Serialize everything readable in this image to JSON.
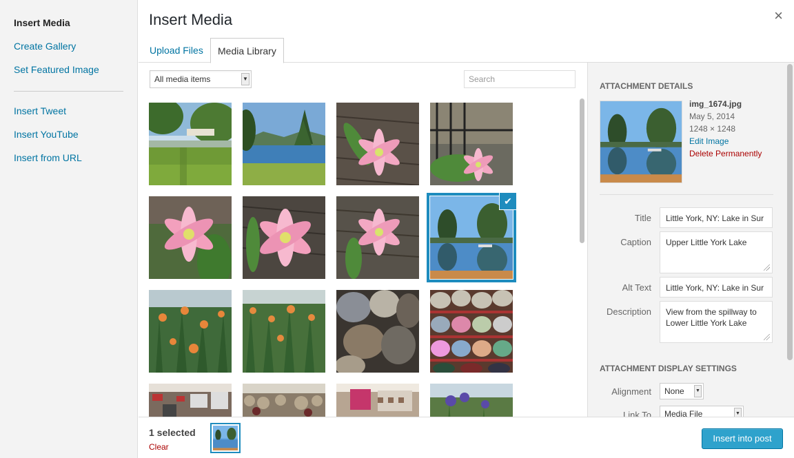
{
  "menu": {
    "items": [
      {
        "label": "Insert Media",
        "active": true
      },
      {
        "label": "Create Gallery"
      },
      {
        "label": "Set Featured Image"
      },
      {
        "label": "Insert Tweet"
      },
      {
        "label": "Insert YouTube"
      },
      {
        "label": "Insert from URL"
      }
    ]
  },
  "header": {
    "title": "Insert Media",
    "close_icon": "×"
  },
  "tabs": [
    {
      "label": "Upload Files",
      "active": false
    },
    {
      "label": "Media Library",
      "active": true
    }
  ],
  "toolbar": {
    "filter_value": "All media items",
    "search_placeholder": "Search"
  },
  "attachment": {
    "heading": "ATTACHMENT DETAILS",
    "filename": "img_1674.jpg",
    "date": "May 5, 2014",
    "dimensions": "1248 × 1248",
    "edit_link": "Edit Image",
    "delete_link": "Delete Permanently",
    "fields": {
      "title_label": "Title",
      "title_value": "Little York, NY: Lake in Sur",
      "caption_label": "Caption",
      "caption_value": "Upper Little York Lake",
      "alt_label": "Alt Text",
      "alt_value": "Little York, NY: Lake in Sur",
      "description_label": "Description",
      "description_value": "View from the spillway to Lower Little York Lake"
    }
  },
  "display_settings": {
    "heading": "ATTACHMENT DISPLAY SETTINGS",
    "alignment_label": "Alignment",
    "alignment_value": "None",
    "link_label": "Link To",
    "link_value": "Media File"
  },
  "footer": {
    "selected_count": "1 selected",
    "clear_label": "Clear",
    "insert_button": "Insert into post"
  },
  "colors": {
    "accent": "#1e8cbe",
    "link": "#0074a2",
    "danger": "#a00"
  }
}
